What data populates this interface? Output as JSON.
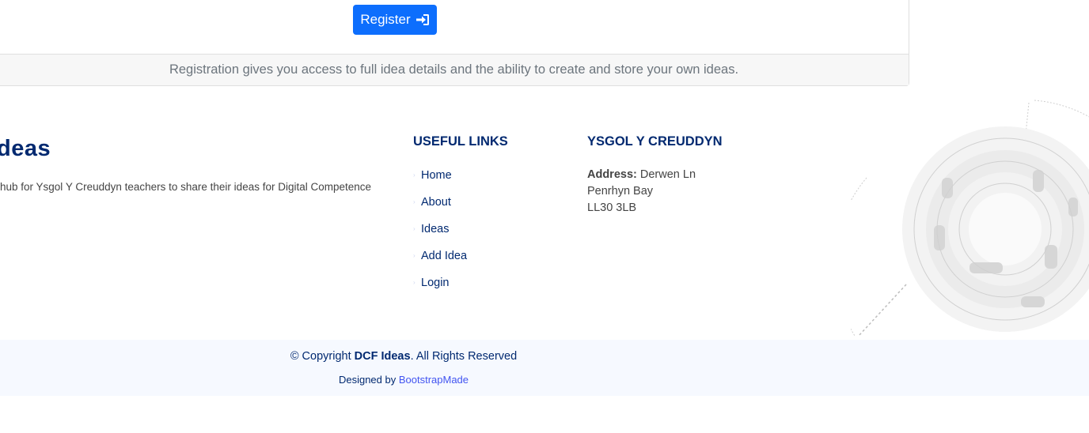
{
  "card": {
    "register_label": "Register",
    "footer_text": "Registration gives you access to full idea details and the ability to create and store your own ideas."
  },
  "footer": {
    "brand": "deas",
    "description": "hub for Ysgol Y Creuddyn teachers to share their ideas for Digital Competence",
    "useful_links_title": "Useful Links",
    "links": [
      "Home",
      "About",
      "Ideas",
      "Add Idea",
      "Login"
    ],
    "school_title": "Ysgol Y Creuddyn",
    "address_label": "Address:",
    "address_line1": "Derwen Ln",
    "address_line2": "Penrhyn Bay",
    "address_line3": "LL30 3LB"
  },
  "bottom": {
    "copyright_prefix": "© Copyright ",
    "copyright_brand": "DCF Ideas",
    "copyright_suffix": ". All Rights Reserved",
    "designed_by": "Designed by ",
    "designer": "BootstrapMade"
  },
  "colors": {
    "primary_button": "#0d6efd",
    "brand_navy": "#012970",
    "link_blue": "#4154f1"
  }
}
